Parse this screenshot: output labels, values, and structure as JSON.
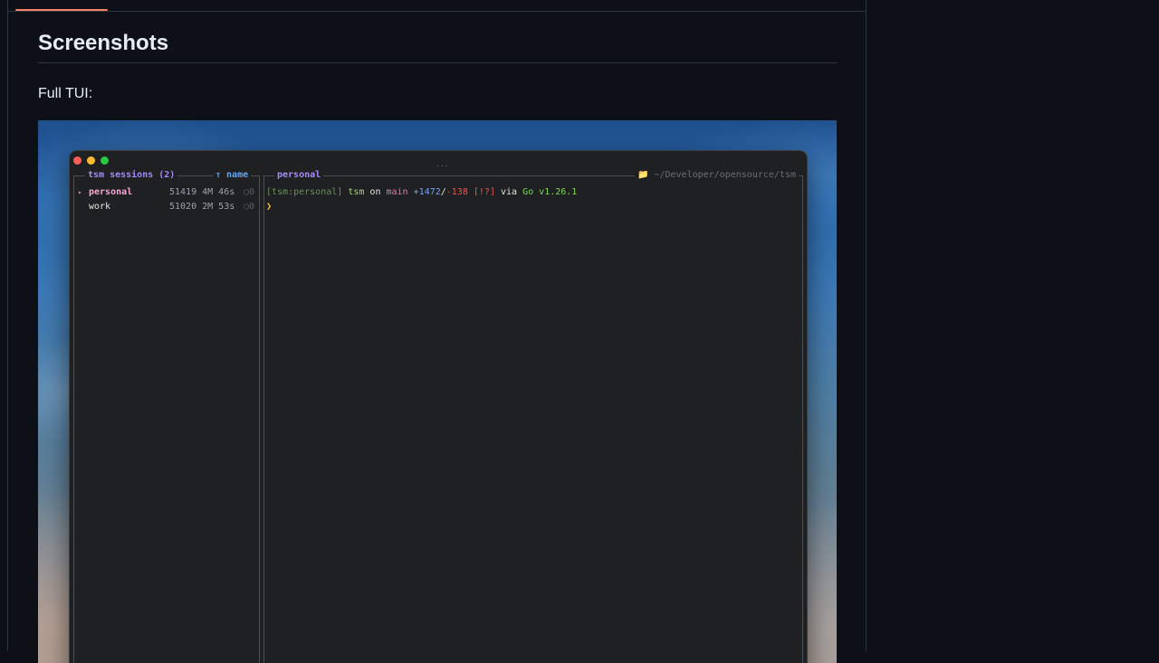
{
  "readme": {
    "heading": "Screenshots",
    "paragraph": "Full TUI:"
  },
  "terminal": {
    "sessions_pane": {
      "title": "tsm sessions (2)",
      "sort_label": "↑ name",
      "rows": [
        {
          "marker": "▸",
          "name": "personal",
          "meta": "51419 4M 46s",
          "count": "○0"
        },
        {
          "marker": "",
          "name": "work",
          "meta": "51020 2M 53s",
          "count": "○0"
        }
      ]
    },
    "main_pane": {
      "title": "personal",
      "path": "📁 ~/Developer/opensource/tsm",
      "prompt": {
        "session_tag": "[tsm:personal]",
        "dir": "tsm",
        "on": "on",
        "branch": " main",
        "added": "+1472",
        "slash": "/",
        "removed": "-138",
        "status": "[!?]",
        "via": "via",
        "lang": "Go v1.26.1"
      },
      "cursor": "❯"
    },
    "grip": "···"
  },
  "colors": {
    "accent_tab": "#f78166",
    "term_bg": "#1e2021",
    "sessions_title": "#a78bfa",
    "sort_label": "#60a5fa"
  }
}
